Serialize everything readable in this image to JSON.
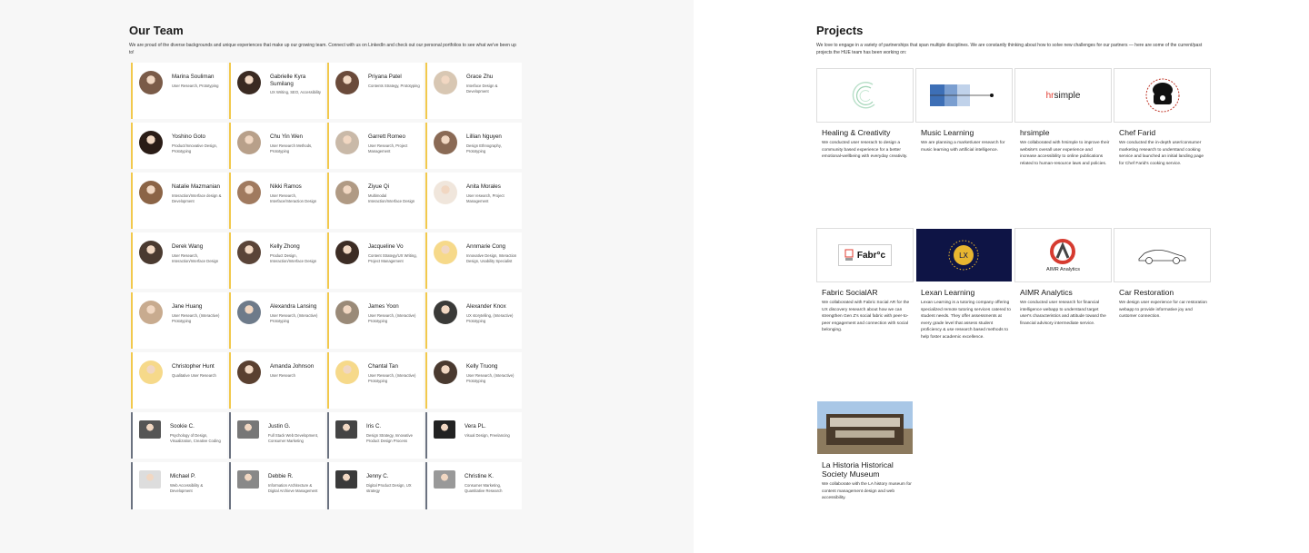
{
  "team": {
    "title": "Our Team",
    "description": "We are proud of the diverse backgrounds and unique experiences that make up our growing team. Connect with us on LinkedIn and check out our personal portfolios to see what we've been up to!",
    "rows": [
      [
        {
          "name": "Marina Souliman",
          "role": "User Research, Prototyping",
          "avatar": "#7a5b48"
        },
        {
          "name": "Gabrielle Kyra Sumilang",
          "role": "UX Writing, SEO, Accessibility",
          "avatar": "#3a2a22"
        },
        {
          "name": "Priyana Patel",
          "role": "Contents Strategy, Prototyping",
          "avatar": "#6a4a3a"
        },
        {
          "name": "Grace Zhu",
          "role": "Interface Design & Development",
          "avatar": "#d8c7b3"
        }
      ],
      [
        {
          "name": "Yoshino Goto",
          "role": "Product/Innovative Design, Prototyping",
          "avatar": "#2a1c16"
        },
        {
          "name": "Chu Yin Wen",
          "role": "User Research Methods, Prototyping",
          "avatar": "#b8a08a"
        },
        {
          "name": "Garrett Romeo",
          "role": "User Research, Project Management",
          "avatar": "#c9b9a8"
        },
        {
          "name": "Lillian Nguyen",
          "role": "Design Ethnography, Prototyping",
          "avatar": "#8a6a55"
        }
      ],
      [
        {
          "name": "Natalie Mazmanian",
          "role": "Interaction/Interface design & Development",
          "avatar": "#8b6446"
        },
        {
          "name": "Nikki Ramos",
          "role": "User Research, Interface/Interaction Design",
          "avatar": "#a07a5f"
        },
        {
          "name": "Ziyue Qi",
          "role": "Multimodal Interaction/Interface Design",
          "avatar": "#b09a84"
        },
        {
          "name": "Anita Morales",
          "role": "User research, Project Management",
          "avatar": "#f0e6dc"
        }
      ],
      [
        {
          "name": "Derek Wang",
          "role": "User Research, Interaction/Interface Design",
          "avatar": "#4a3a30"
        },
        {
          "name": "Kelly Zhong",
          "role": "Product Design, Interaction/Interface Design",
          "avatar": "#5a4438"
        },
        {
          "name": "Jacqueline Vo",
          "role": "Content Strategy/UX Writing, Project Management",
          "avatar": "#3c2c24"
        },
        {
          "name": "Annmarie Cong",
          "role": "Innovative Design, Interaction Design, Usability Specialist",
          "avatar": "#f6d98a"
        }
      ],
      [
        {
          "name": "Jane Huang",
          "role": "User Research, (Interactive) Prototyping",
          "avatar": "#c8ab8f"
        },
        {
          "name": "Alexandra Lansing",
          "role": "User Research, (Interactive) Prototyping",
          "avatar": "#6e7b8a"
        },
        {
          "name": "James Yoon",
          "role": "User Research, (Interactive) Prototyping",
          "avatar": "#9a8a78"
        },
        {
          "name": "Alexander Knox",
          "role": "UX storytelling, (Interactive) Prototyping",
          "avatar": "#3a3a38"
        }
      ],
      [
        {
          "name": "Christopher Hunt",
          "role": "Qualitative User Research",
          "avatar": "#f6d98a"
        },
        {
          "name": "Amanda Johnson",
          "role": "User Research",
          "avatar": "#5a4030"
        },
        {
          "name": "Chantal Tan",
          "role": "User Research, (Interactive) Prototyping",
          "avatar": "#f6d98a"
        },
        {
          "name": "Kelly Truong",
          "role": "User Research, (Interactive) Prototyping",
          "avatar": "#4a3a30"
        }
      ],
      [
        {
          "name": "Sookie C.",
          "role": "Psychology of Design, Visualization, Creative Coding",
          "avatar": "#555555"
        },
        {
          "name": "Justin G.",
          "role": "Full Stack Web Development, Consumer Marketing",
          "avatar": "#777777"
        },
        {
          "name": "Iris C.",
          "role": "Design Strategy, Innovative Product Design Process",
          "avatar": "#444444"
        },
        {
          "name": "Vera PL.",
          "role": "Visual Design, Freelancing",
          "avatar": "#222222"
        }
      ],
      [
        {
          "name": "Michael P.",
          "role": "Web Accessibility & Development",
          "avatar": "#dddddd"
        },
        {
          "name": "Debbie R.",
          "role": "Information Architecture & Digital Archieve Management",
          "avatar": "#888888"
        },
        {
          "name": "Jenny C.",
          "role": "Digital Product Design, UX strategy",
          "avatar": "#3a3a3a"
        },
        {
          "name": "Christine K.",
          "role": "Consumer Marketing, Quantitative Research",
          "avatar": "#999999"
        }
      ]
    ]
  },
  "projects": {
    "title": "Projects",
    "description": "We love to engage in a variety of partnerships that span multiple disciplines. We are constantly thinking about how to solve new challenges for our partners — here are some of the current/past projects the HUE team has been working on:",
    "rows": [
      [
        {
          "title": "Healing & Creativity",
          "desc": "We conducted user reserach to design a community based experience for a better emotional-wellbeing with everyday creativity.",
          "thumb": "healing"
        },
        {
          "title": "Music Learning",
          "desc": "We are planning a market/user research for music learning with artificial intelligence.",
          "thumb": "music"
        },
        {
          "title": "hrsimple",
          "desc": "We collaborated with hrsimple to improve their website's overall user experience and increase accessibility to online publications related to human-resource laws and policies.",
          "thumb": "hrsimple",
          "logo_hr": "hr",
          "logo_rest": "simple"
        },
        {
          "title": "Chef Farid",
          "desc": "We conducted the in-depth user/consumer marketing research to understand cooking service and launched an initial landing page for Chef Farid's cooking service.",
          "thumb": "chef"
        }
      ],
      [
        {
          "title": "Fabric SocialAR",
          "desc": "We collaborated with Fabric Social AR for the UX discovery research about how we can strengthen Gen Z's social fabric with peer-to-peer engagement and connection with social belonging.",
          "thumb": "fabric",
          "logo_text": "Fabr°c"
        },
        {
          "title": "Lexan Learning",
          "desc": "Lexan Learning is a tutoring company offering specialized remote tutoring services catered to student needs. They offer assessments at every grade level that assess student proficiency & use research based methods to help foster academic excellence.",
          "thumb": "lexan",
          "logo_text": "LX"
        },
        {
          "title": "AIMR Analytics",
          "desc": "We conducted user research for financial intelligence webapp to understand target user's characteristics and attitude toward the financial advisory intermediate service.",
          "thumb": "aimr",
          "logo_text": "AIMR Analytics"
        },
        {
          "title": "Car Restoration",
          "desc": "We design user experience for car restoration webapp to provide informative joy and customer connection.",
          "thumb": "car"
        }
      ],
      [
        {
          "title": "La Historia Historical Society Museum",
          "desc": "We collaborate with the LA history museum for content management design and web accessibility.",
          "thumb": "museum"
        }
      ]
    ]
  },
  "colors": {
    "accent_border": "#f2c94c",
    "alt_border": "#6b7280",
    "left_bg": "#f7f7f7"
  }
}
